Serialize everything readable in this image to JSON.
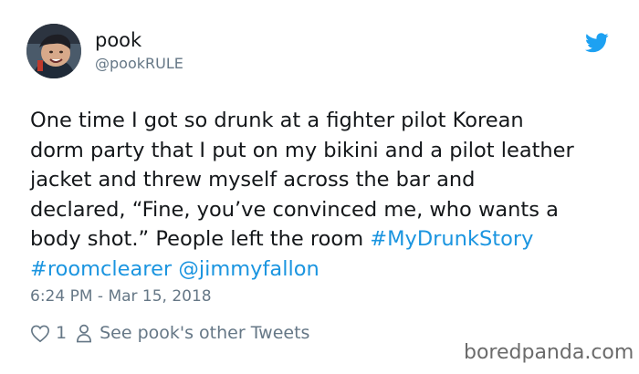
{
  "user": {
    "name": "pook",
    "handle": "@pookRULE"
  },
  "tweet": {
    "text_lines": [
      "One time I got so drunk at a fighter pilot Korean",
      "dorm party that I put on my bikini and a pilot leather",
      "jacket and threw myself across the bar and",
      "declared, “Fine, you’ve convinced me, who wants a",
      "body shot.” People left the room "
    ],
    "tags": [
      "#MyDrunkStory",
      "#roomclearer",
      "@jimmyfallon"
    ],
    "timestamp": "6:24 PM - Mar 15, 2018"
  },
  "actions": {
    "like_count": "1",
    "see_more_label": "See pook's other Tweets"
  },
  "watermark": "boredpanda.com",
  "colors": {
    "link": "#1b95e0",
    "muted": "#657786",
    "twitter_blue": "#1da1f2"
  },
  "icons": [
    "avatar",
    "twitter-bird-icon",
    "heart-icon",
    "person-icon"
  ]
}
